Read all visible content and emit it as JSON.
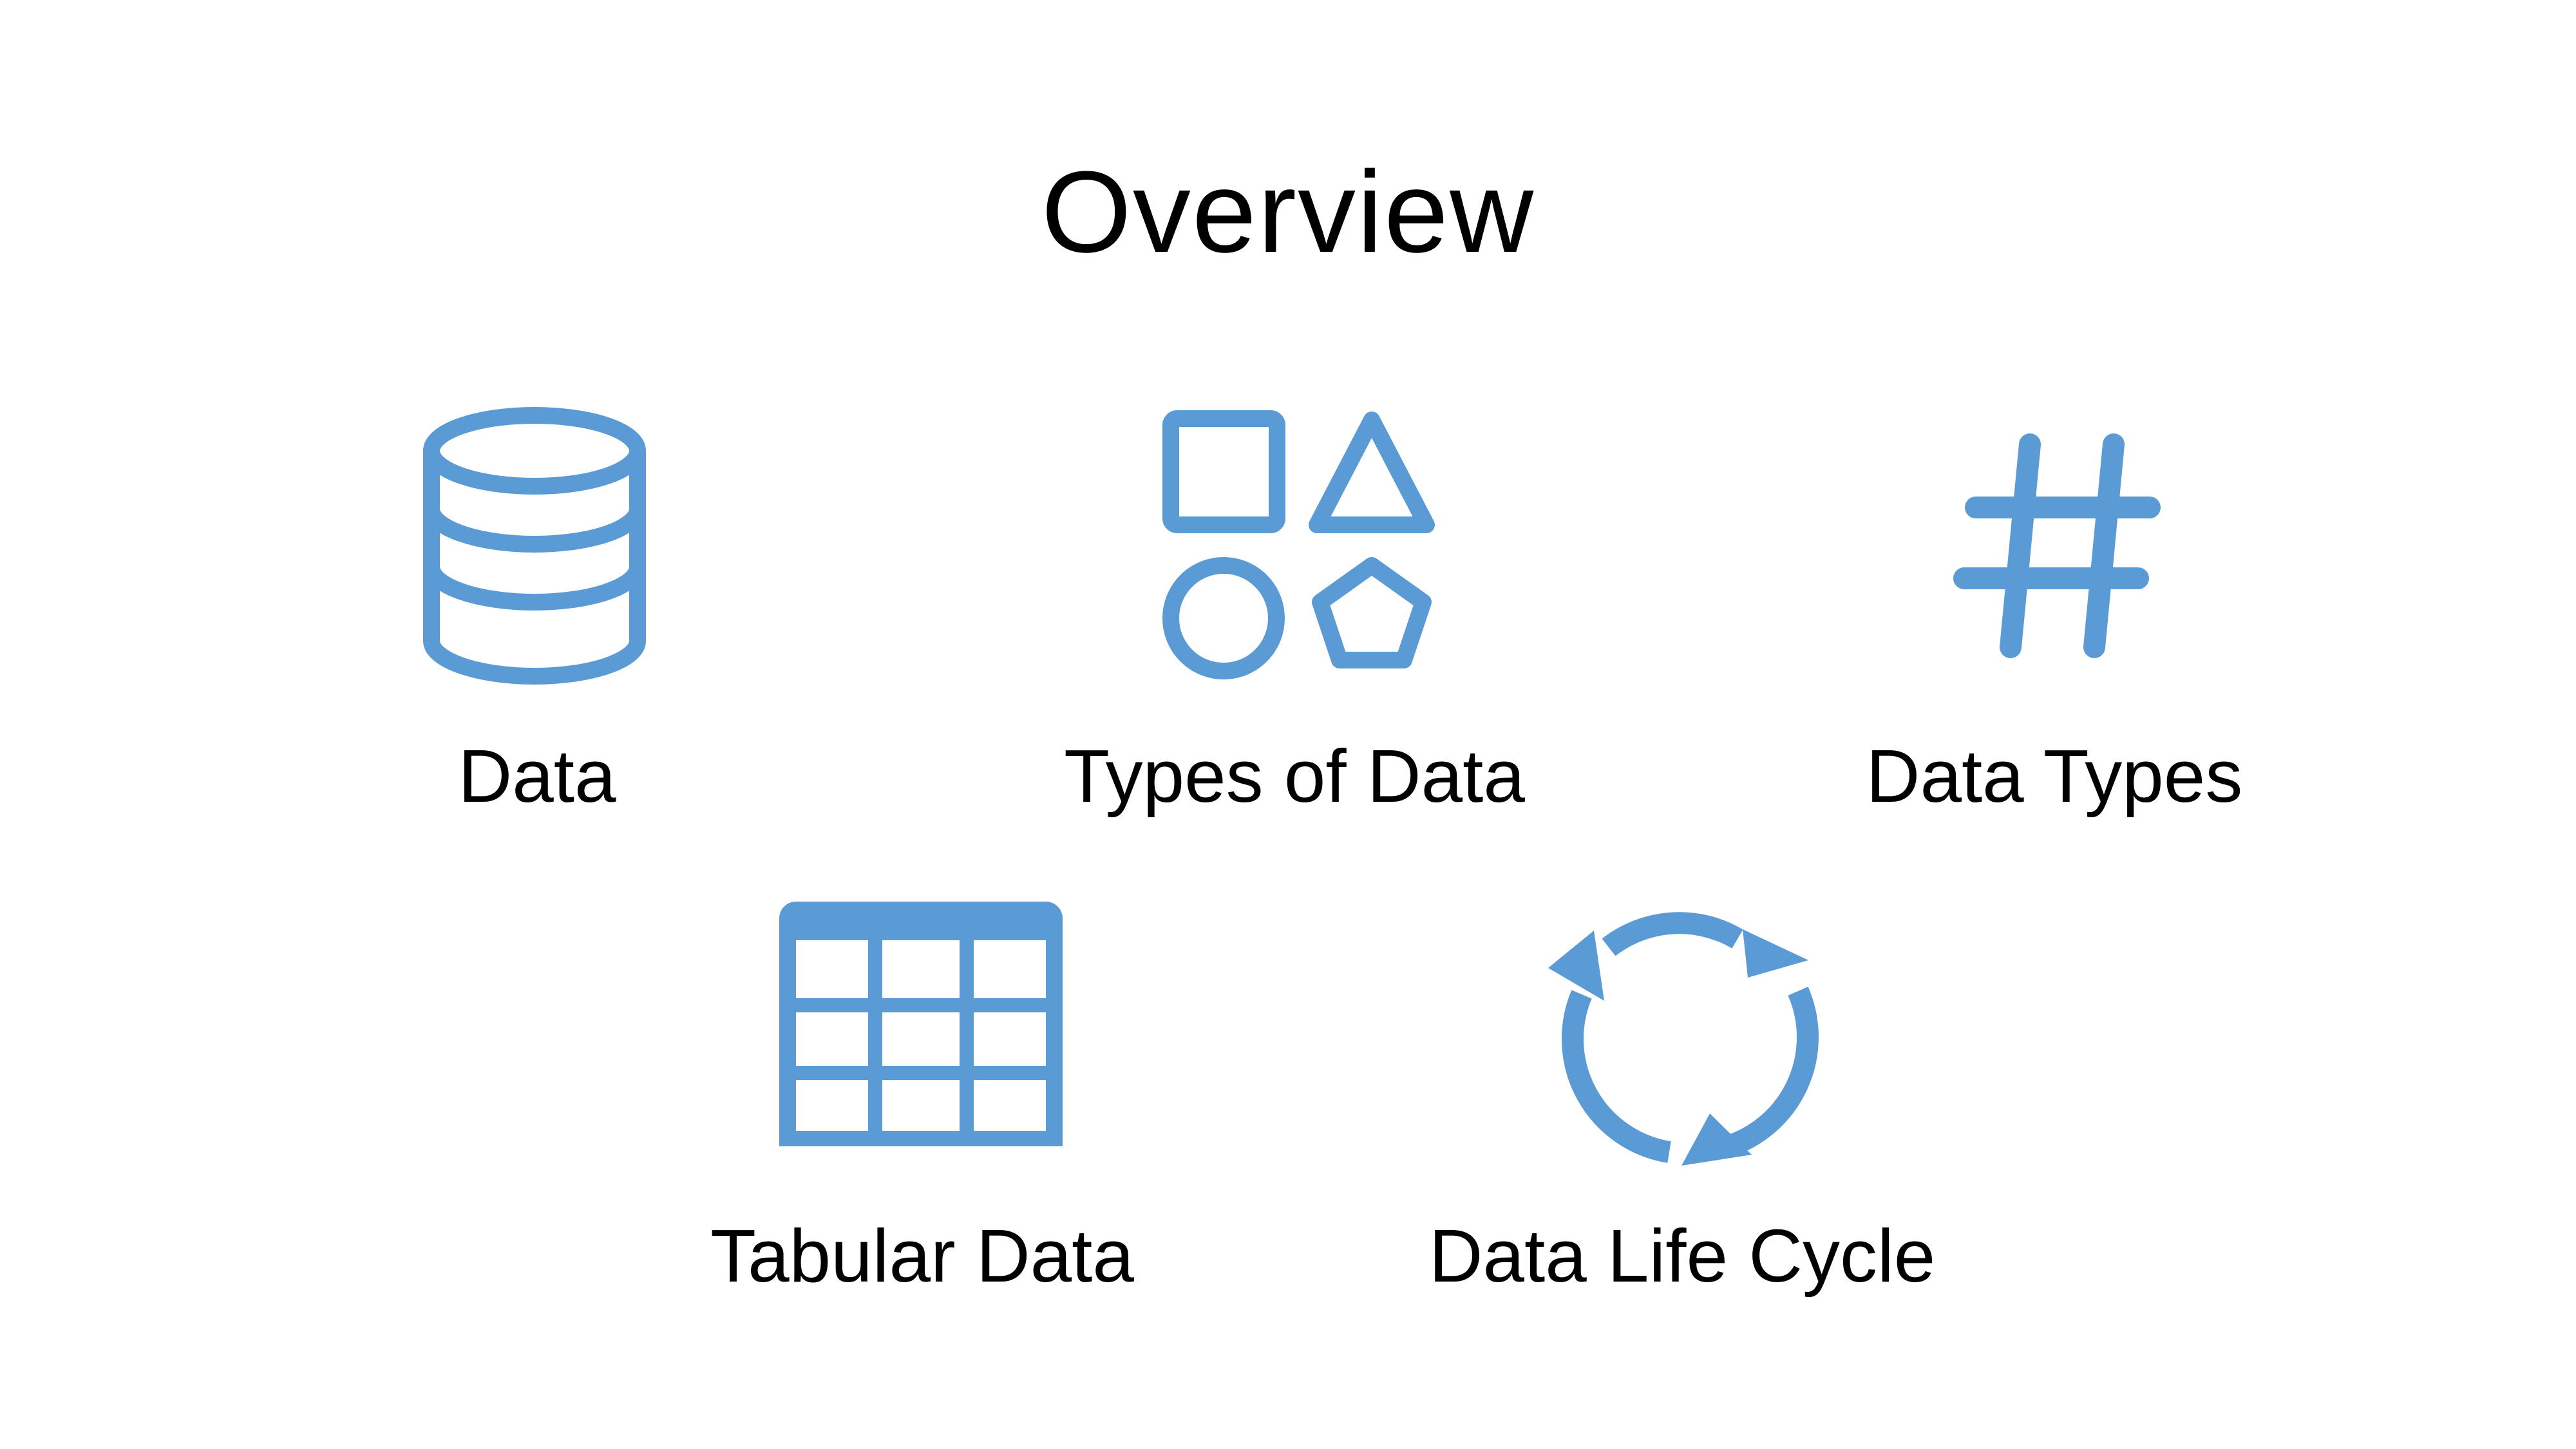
{
  "slide": {
    "title": "Overview",
    "accent_color": "#5B9BD5",
    "items": [
      {
        "label": "Data",
        "icon": "database-icon"
      },
      {
        "label": "Types of Data",
        "icon": "shapes-icon"
      },
      {
        "label": "Data Types",
        "icon": "hashtag-icon"
      },
      {
        "label": "Tabular Data",
        "icon": "table-icon"
      },
      {
        "label": "Data Life Cycle",
        "icon": "cycle-arrows-icon"
      }
    ]
  }
}
